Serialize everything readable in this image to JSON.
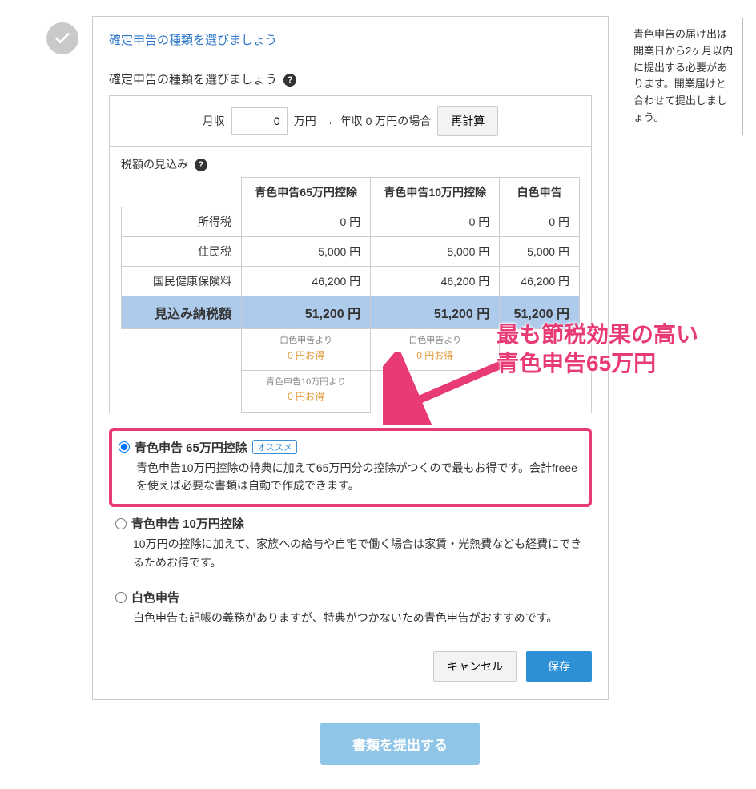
{
  "header": {
    "title": "確定申告の種類を選びましょう"
  },
  "section": {
    "label": "確定申告の種類を選びましょう"
  },
  "calc": {
    "monthly_label": "月収",
    "monthly_value": "0",
    "unit1": "万円",
    "arrow": "→",
    "yearly_label": "年収 0 万円の場合",
    "recalc": "再計算"
  },
  "tax": {
    "label": "税額の見込み",
    "cols": [
      "青色申告65万円控除",
      "青色申告10万円控除",
      "白色申告"
    ],
    "rows": [
      {
        "name": "所得税",
        "vals": [
          "0 円",
          "0 円",
          "0 円"
        ]
      },
      {
        "name": "住民税",
        "vals": [
          "5,000 円",
          "5,000 円",
          "5,000 円"
        ]
      },
      {
        "name": "国民健康保険料",
        "vals": [
          "46,200 円",
          "46,200 円",
          "46,200 円"
        ]
      },
      {
        "name": "見込み納税額",
        "vals": [
          "51,200 円",
          "51,200 円",
          "51,200 円"
        ]
      }
    ],
    "savings1": {
      "note": "白色申告より",
      "amount": "0 円お得"
    },
    "savings2": {
      "note": "白色申告より",
      "amount": "0 円お得"
    },
    "savings3": {
      "note": "青色申告10万円より",
      "amount": "0 円お得"
    }
  },
  "options": [
    {
      "title": "青色申告 65万円控除",
      "badge": "オススメ",
      "desc": "青色申告10万円控除の特典に加えて65万円分の控除がつくので最もお得です。会計freeeを使えば必要な書類は自動で作成できます。"
    },
    {
      "title": "青色申告 10万円控除",
      "desc": "10万円の控除に加えて、家族への給与や自宅で働く場合は家賃・光熱費なども経費にできるためお得です。"
    },
    {
      "title": "白色申告",
      "desc": "白色申告も記帳の義務がありますが、特典がつかないため青色申告がおすすめです。"
    }
  ],
  "actions": {
    "cancel": "キャンセル",
    "save": "保存"
  },
  "submit": "書類を提出する",
  "tooltip": "青色申告の届け出は開業日から2ヶ月以内に提出する必要があります。開業届けと合わせて提出しましょう。",
  "annotation": {
    "line1": "最も節税効果の高い",
    "line2": "青色申告65万円"
  }
}
